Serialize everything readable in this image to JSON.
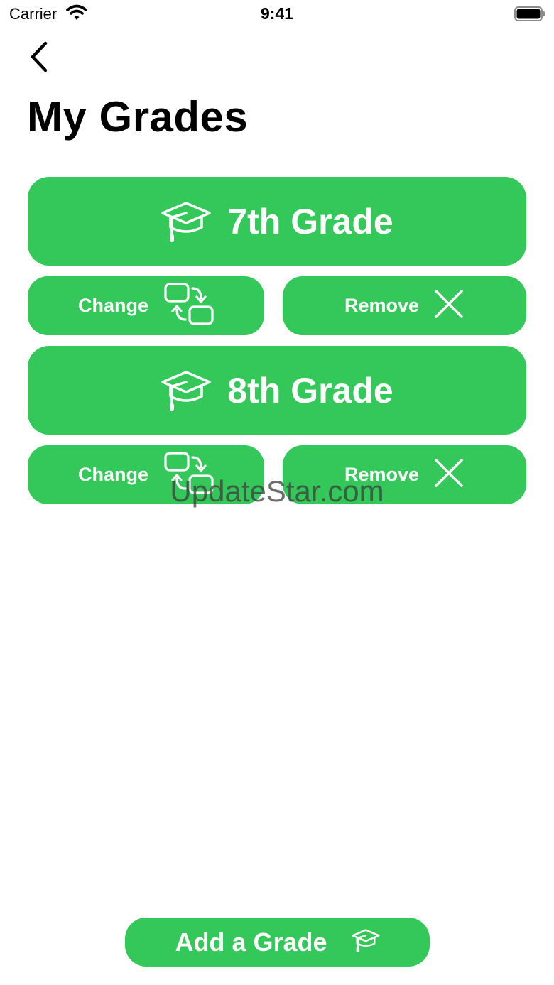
{
  "status_bar": {
    "carrier": "Carrier",
    "time": "9:41"
  },
  "header": {
    "title": "My Grades"
  },
  "grades": [
    {
      "label": "7th Grade",
      "change_label": "Change",
      "remove_label": "Remove"
    },
    {
      "label": "8th Grade",
      "change_label": "Change",
      "remove_label": "Remove"
    }
  ],
  "footer": {
    "add_label": "Add a Grade"
  },
  "watermark": "UpdateStar.com",
  "colors": {
    "accent": "#34c759",
    "text": "#000000",
    "on_accent": "#ffffff"
  },
  "icons": {
    "back": "chevron-left-icon",
    "grade": "graduation-cap-icon",
    "change": "swap-icon",
    "remove": "close-icon"
  }
}
